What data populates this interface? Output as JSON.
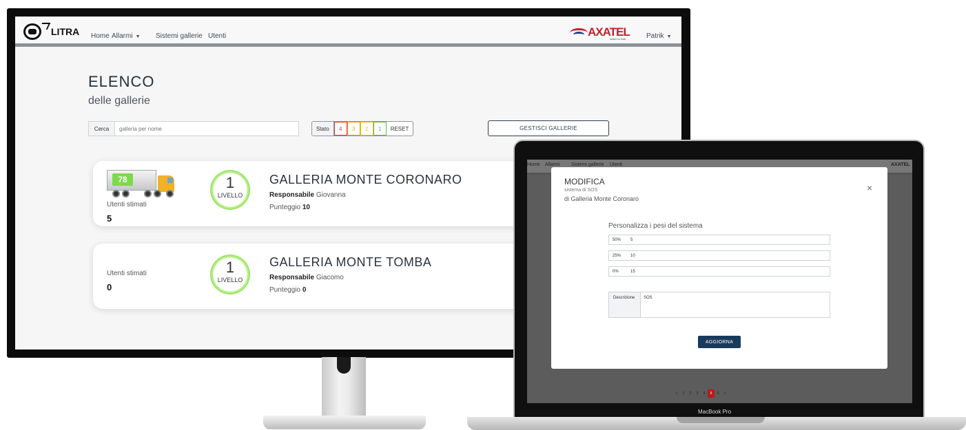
{
  "monitor": {
    "app": {
      "brand": "LITRA",
      "nav": [
        "Home",
        "Allarmi",
        "Sistemi gallerie",
        "Utenti"
      ],
      "partner_logo": "AXATEL",
      "partner_logo_tag": "SMART FUTURE",
      "user_menu": "Patrik",
      "title": "ELENCO",
      "subtitle": "delle gallerie",
      "search": {
        "label": "Cerca",
        "placeholder": "galleria per nome",
        "value": ""
      },
      "stato": {
        "label": "Stato",
        "levels": [
          {
            "label": "4",
            "color": "#e53935"
          },
          {
            "label": "3",
            "color": "#f39c12"
          },
          {
            "label": "2",
            "color": "#f1c40f"
          },
          {
            "label": "1",
            "color": "#6ab04c"
          }
        ],
        "reset": "RESET"
      },
      "manage_button": "GESTISCI GALLERIE",
      "galleries": [
        {
          "truck_count": "78",
          "users_label": "Utenti stimati",
          "users_value": "5",
          "level_number": "1",
          "level_label": "LIVELLO",
          "name": "GALLERIA MONTE CORONARO",
          "responsible_label": "Responsabile",
          "responsible_name": "Giovanna",
          "score_label": "Punteggio",
          "score_value": "10"
        },
        {
          "users_label": "Utenti stimati",
          "users_value": "0",
          "level_number": "1",
          "level_label": "LIVELLO",
          "name": "GALLERIA MONTE TOMBA",
          "responsible_label": "Responsabile",
          "responsible_name": "Giacomo",
          "score_label": "Punteggio",
          "score_value": "0"
        }
      ]
    }
  },
  "laptop": {
    "brand": "MacBook Pro",
    "background_nav": [
      "Home",
      "Allarmi",
      "Sistemi gallerie",
      "Utenti"
    ],
    "background_logo": "AXATEL",
    "modal": {
      "title": "MODIFICA",
      "subtitle_1": "sistema di SOS",
      "subtitle_2": "di Galleria Monte Coronaro",
      "close": "×",
      "section_title": "Personalizza i pesi del sistema",
      "weights": [
        {
          "prefix": "50%",
          "value": "5"
        },
        {
          "prefix": "25%",
          "value": "10"
        },
        {
          "prefix": "0%",
          "value": "15"
        }
      ],
      "description_label": "Descrizione",
      "description_value": "SOS",
      "submit": "AGGIORNA"
    },
    "pagination": {
      "items": [
        "«",
        "1",
        "2",
        "3",
        "4",
        "5",
        "6",
        "»"
      ],
      "active": "5"
    }
  }
}
